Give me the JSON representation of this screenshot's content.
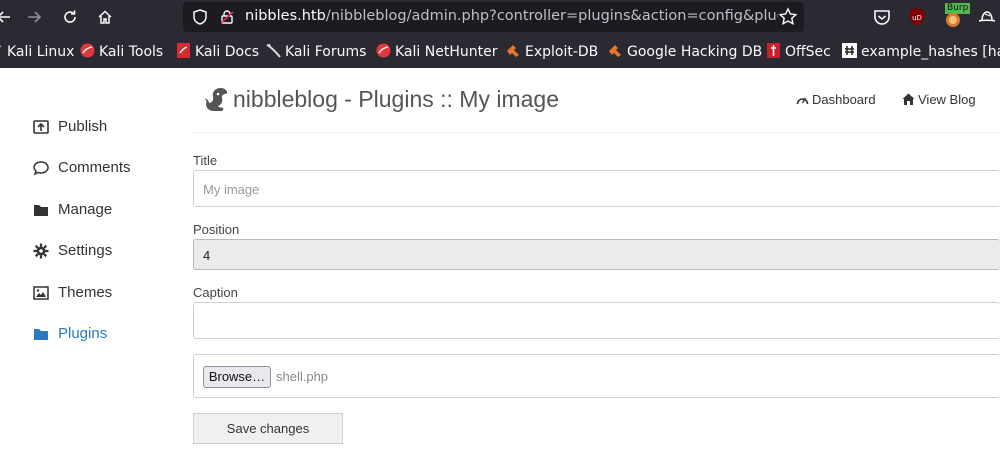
{
  "browser": {
    "url_host": "nibbles.htb",
    "url_path": "/nibbleblog/admin.php?controller=plugins&action=config&plugin",
    "extensions": [
      "pocket-icon",
      "ublock-icon",
      "burp-icon",
      "hat-icon"
    ],
    "burp_badge": "Burp",
    "bookmarks": [
      {
        "label": "Kali Linux",
        "icon": "kali-dragon-icon"
      },
      {
        "label": "Kali Tools",
        "icon": "kali-tools-icon"
      },
      {
        "label": "Kali Docs",
        "icon": "kali-docs-icon"
      },
      {
        "label": "Kali Forums",
        "icon": "kali-forums-icon"
      },
      {
        "label": "Kali NetHunter",
        "icon": "kali-nethunter-icon"
      },
      {
        "label": "Exploit-DB",
        "icon": "exploit-db-icon"
      },
      {
        "label": "Google Hacking DB",
        "icon": "ghdb-icon"
      },
      {
        "label": "OffSec",
        "icon": "offsec-icon"
      },
      {
        "label": "example_hashes [has",
        "icon": "hashcat-icon"
      }
    ]
  },
  "sidebar": {
    "items": [
      {
        "label": "Publish",
        "icon": "publish-icon",
        "active": false
      },
      {
        "label": "Comments",
        "icon": "comment-icon",
        "active": false
      },
      {
        "label": "Manage",
        "icon": "folder-icon",
        "active": false
      },
      {
        "label": "Settings",
        "icon": "gear-icon",
        "active": false
      },
      {
        "label": "Themes",
        "icon": "image-icon",
        "active": false
      },
      {
        "label": "Plugins",
        "icon": "folder-open-icon",
        "active": true
      }
    ]
  },
  "header": {
    "title": "nibbleblog - Plugins :: My image",
    "dashboard_label": "Dashboard",
    "view_blog_label": "View Blog"
  },
  "form": {
    "title_label": "Title",
    "title_placeholder": "My image",
    "position_label": "Position",
    "position_value": "4",
    "caption_label": "Caption",
    "caption_value": "",
    "browse_label": "Browse…",
    "file_name": "shell.php",
    "save_label": "Save changes"
  },
  "colors": {
    "chrome_bg": "#2b2a33",
    "urlbar_bg": "#1c1b22",
    "accent": "#2a7abf"
  }
}
